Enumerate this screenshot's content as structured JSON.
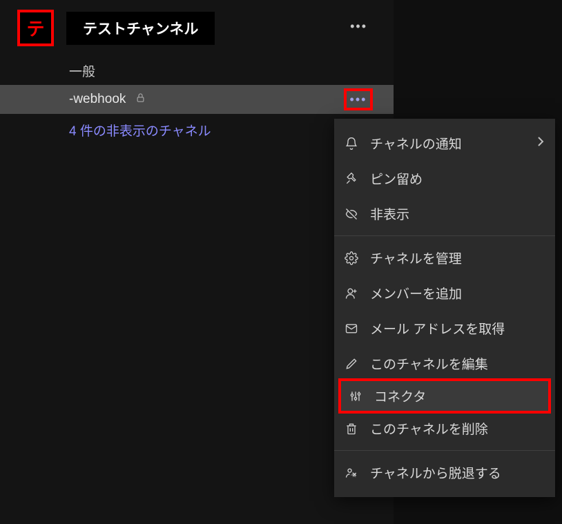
{
  "team": {
    "avatar_letter": "テ",
    "name": "テストチャンネル"
  },
  "channels": {
    "general": "一般",
    "webhook": "-webhook",
    "hidden_link": "4 件の非表示のチャネル"
  },
  "menu": {
    "notify": "チャネルの通知",
    "pin": "ピン留め",
    "hide": "非表示",
    "manage": "チャネルを管理",
    "add_member": "メンバーを追加",
    "get_email": "メール アドレスを取得",
    "edit": "このチャネルを編集",
    "connectors": "コネクタ",
    "delete": "このチャネルを削除",
    "leave": "チャネルから脱退する"
  }
}
